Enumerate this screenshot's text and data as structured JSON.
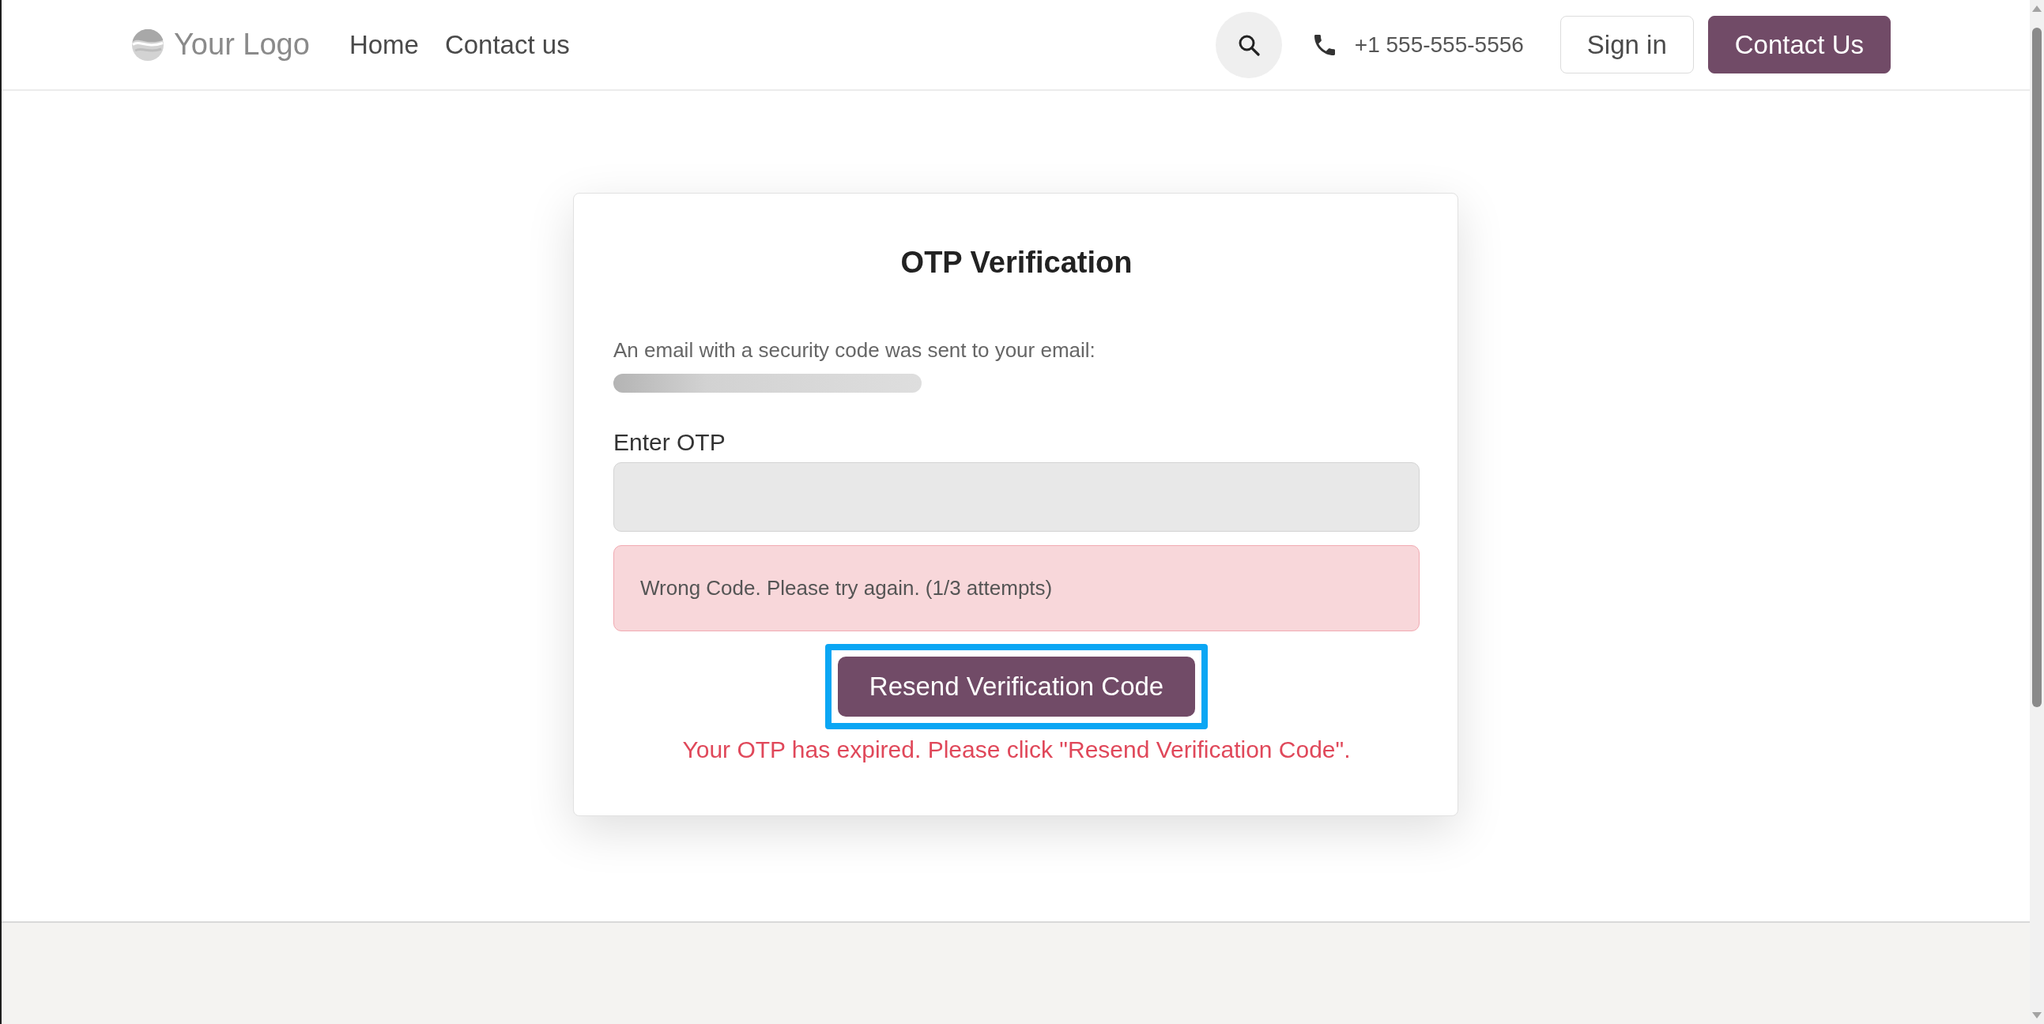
{
  "header": {
    "logo": "Your Logo",
    "nav": [
      {
        "label": "Home"
      },
      {
        "label": "Contact us"
      }
    ],
    "phone": "+1 555-555-5556",
    "buttons": [
      {
        "label": "Sign in",
        "kind": "outline"
      },
      {
        "label": "Contact Us",
        "kind": "primary"
      }
    ]
  },
  "card": {
    "title": "OTP Verification",
    "message": "An email with a security code was sent to your email:",
    "email_blurred": true,
    "otp_field": {
      "label": "Enter OTP",
      "disabled": true
    },
    "alert": {
      "kind": "danger",
      "text": "Wrong Code. Please try again. (1/3 attempts)"
    },
    "resend_button": {
      "label": "Resend Verification Code",
      "focused": true
    },
    "expired_note": "Your OTP has expired. Please click \"Resend Verification Code\"."
  }
}
